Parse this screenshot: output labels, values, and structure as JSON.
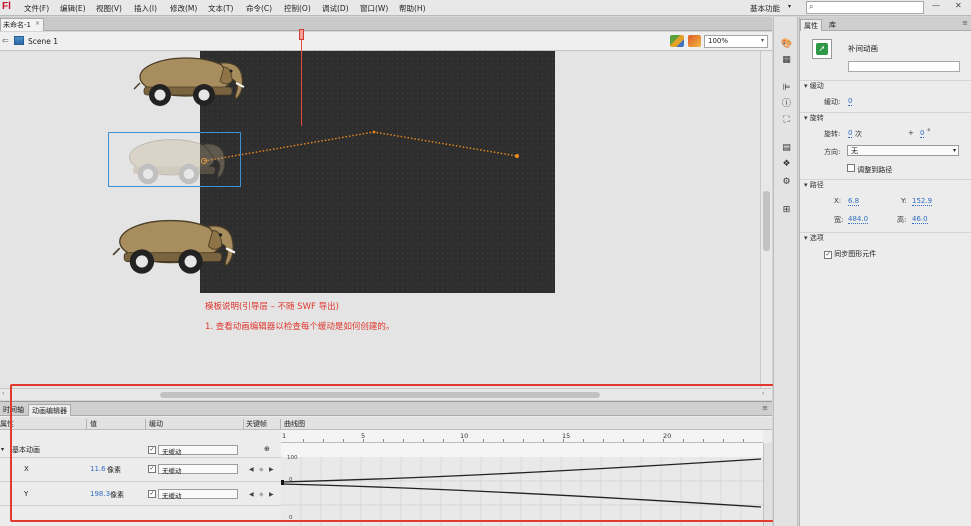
{
  "app": {
    "logo": "Fl"
  },
  "menu": {
    "items": [
      "文件(F)",
      "编辑(E)",
      "视图(V)",
      "插入(I)",
      "修改(M)",
      "文本(T)",
      "命令(C)",
      "控制(O)",
      "调试(D)",
      "窗口(W)",
      "帮助(H)"
    ],
    "workspace": "基本功能",
    "workspace_arrow": "▾",
    "search_placeholder": ""
  },
  "icons": {
    "search": "⌕",
    "minimize": "—",
    "close": "✕",
    "back": "⇐",
    "dropdown": "▾",
    "tab_close": "×",
    "expand": "▾",
    "check": "✓",
    "prev_key": "◀",
    "add_key": "◆",
    "next_key": "▶",
    "panel_menu": "≡",
    "scroll_left": "‹",
    "scroll_right": "›"
  },
  "document": {
    "tab_label": "未命名-1",
    "scene_label": "Scene 1",
    "zoom": "100%"
  },
  "stage_notes": {
    "title": "模板说明(引导层 – 不随 SWF 导出)",
    "step1": "1. 查看动画编辑器以检查每个缓动是如何创建的。"
  },
  "motion_editor": {
    "tabs": [
      "时间轴",
      "动画编辑器"
    ],
    "columns": {
      "property": "属性",
      "value": "值",
      "ease": "缓动",
      "keyframe": "关键帧",
      "graph": "曲线图"
    },
    "ruler_marks": [
      "1",
      "5",
      "10",
      "15",
      "20"
    ],
    "graph_axis_labels": {
      "top": "100",
      "mid": "0",
      "bottom": "0"
    },
    "sections": [
      {
        "name": "基本动画",
        "ease": "无缓动"
      }
    ],
    "properties": [
      {
        "name": "X",
        "value": "11.6",
        "unit": "像素",
        "ease": "无缓动"
      },
      {
        "name": "Y",
        "value": "198.3",
        "unit": "像素",
        "ease": "无缓动"
      }
    ]
  },
  "properties_panel": {
    "tabs": [
      "属性",
      "库"
    ],
    "instance_type": "补间动画",
    "sections": {
      "ease": "缓动",
      "rotation": "旋转",
      "path": "路径",
      "options": "选项"
    },
    "ease_label": "缓动:",
    "ease_value": "0",
    "rotate_label": "旋转:",
    "rotate_times": "0",
    "rotate_times_unit": "次",
    "rotate_plus": "+",
    "rotate_degrees": "0",
    "rotate_degree_unit": "°",
    "direction_label": "方向:",
    "direction_value": "无",
    "orient_to_path_label": "调整到路径",
    "x_label": "X:",
    "x_value": "6.8",
    "y_label": "Y:",
    "y_value": "152.9",
    "w_label": "宽:",
    "w_value": "484.0",
    "h_label": "高:",
    "h_value": "46.0",
    "sync_label": "同步图形元件"
  },
  "colors": {
    "annotation_red": "#e23a2e",
    "stage": "#2e2e2e",
    "path_orange": "#f08a1c",
    "selection_blue": "#3f92d2",
    "value_blue": "#2f6fc2"
  }
}
